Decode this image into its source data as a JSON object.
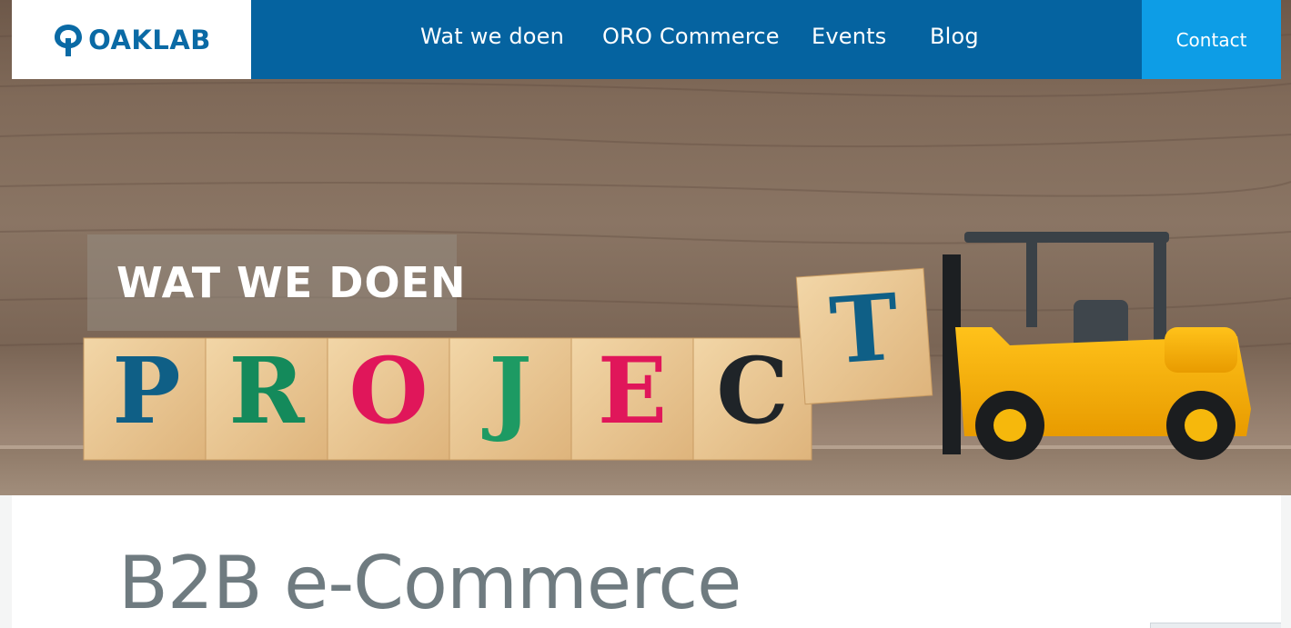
{
  "header": {
    "logo_text": "OAKLAB",
    "nav": [
      "Wat we doen",
      "ORO Commerce",
      "Events",
      "Blog"
    ],
    "contact_label": "Contact"
  },
  "hero": {
    "label": "WAT WE DOEN",
    "blocks": [
      {
        "letter": "P",
        "color": "#0f5f86"
      },
      {
        "letter": "R",
        "color": "#148a5b"
      },
      {
        "letter": "O",
        "color": "#e0165a"
      },
      {
        "letter": "J",
        "color": "#1d9a63"
      },
      {
        "letter": "E",
        "color": "#e0165a"
      },
      {
        "letter": "C",
        "color": "#1f2428"
      },
      {
        "letter": "T",
        "color": "#0f5f86"
      }
    ]
  },
  "main": {
    "heading": "B2B e-Commerce"
  },
  "colors": {
    "nav_bg": "#0563a0",
    "contact_bg": "#0d9de6",
    "logo": "#0a6aa5",
    "heading": "#6f7b80"
  }
}
